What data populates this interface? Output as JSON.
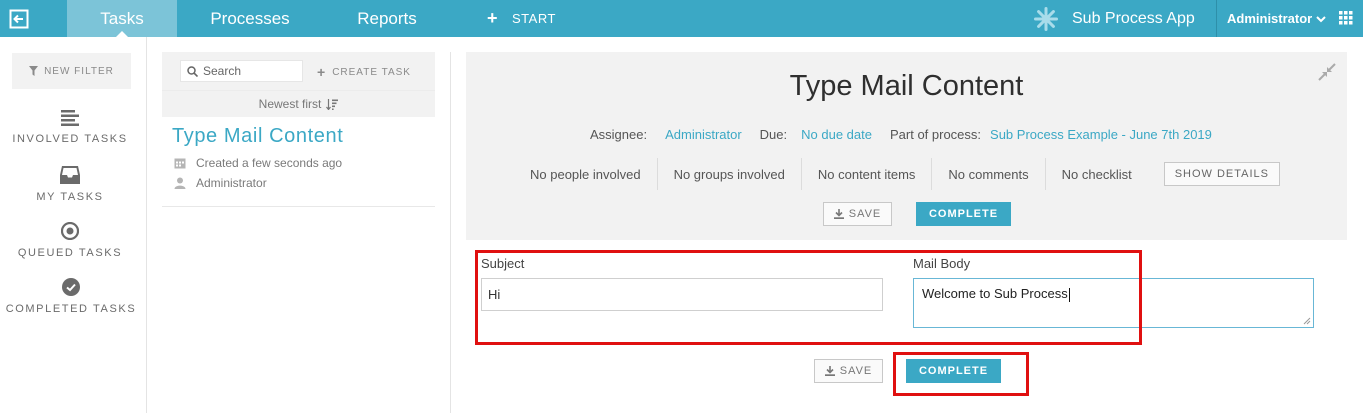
{
  "topbar": {
    "tabs": [
      "Tasks",
      "Processes",
      "Reports"
    ],
    "start_label": "START",
    "app_name": "Sub Process App",
    "user": "Administrator"
  },
  "leftnav": {
    "new_filter": "NEW FILTER",
    "items": [
      {
        "label": "INVOLVED TASKS",
        "icon": "list-icon"
      },
      {
        "label": "MY TASKS",
        "icon": "inbox-icon"
      },
      {
        "label": "QUEUED TASKS",
        "icon": "target-icon"
      },
      {
        "label": "COMPLETED TASKS",
        "icon": "check-circle-icon"
      }
    ]
  },
  "tasklist": {
    "search_placeholder": "Search",
    "create_task": "CREATE TASK",
    "sort_label": "Newest first",
    "task": {
      "title": "Type Mail Content",
      "created": "Created a few seconds ago",
      "assignee": "Administrator"
    }
  },
  "detail": {
    "title": "Type Mail Content",
    "assignee_label": "Assignee:",
    "assignee": "Administrator",
    "due_label": "Due:",
    "due": "No due date",
    "process_label": "Part of process:",
    "process": "Sub Process Example - June 7th 2019",
    "counts": [
      "No people involved",
      "No groups involved",
      "No content items",
      "No comments",
      "No checklist"
    ],
    "show_details": "SHOW DETAILS",
    "save": "SAVE",
    "complete": "COMPLETE"
  },
  "form": {
    "subject_label": "Subject",
    "subject_value": "Hi",
    "body_label": "Mail Body",
    "body_value": "Welcome to Sub Process",
    "save": "SAVE",
    "complete": "COMPLETE"
  },
  "colors": {
    "accent": "#3ba8c5",
    "highlight": "#e01010",
    "panel": "#f2f2f2"
  }
}
